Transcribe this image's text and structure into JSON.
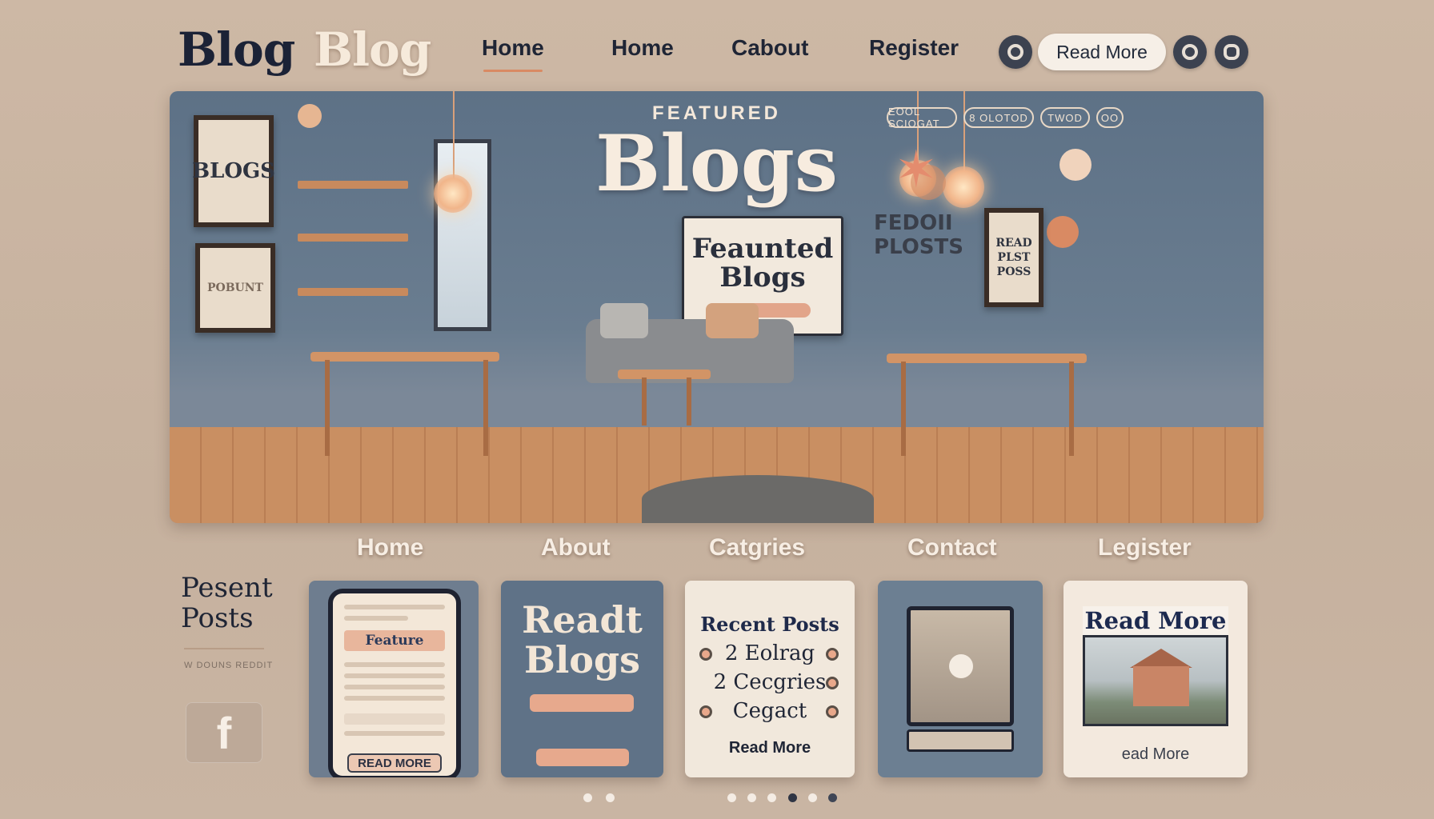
{
  "header": {
    "logo_primary": "Blog",
    "logo_secondary": "Blog",
    "nav": [
      "Home",
      "Home",
      "Cabout",
      "Register"
    ],
    "cta_label": "Read More",
    "icons": [
      "search-icon",
      "record-icon",
      "user-icon"
    ]
  },
  "hero": {
    "kicker": "FEATURED",
    "title": "Blogs",
    "board_title": "Feaunted Blogs",
    "left_frame_top": "BLOGS",
    "left_frame_bottom": "POBUNT",
    "right_sign": "FEDOII PLOSTS",
    "right_frame": "READ PLST POSS",
    "chips": [
      "EOOL SCIOGAT",
      "8 OLOTOD",
      "TWOD",
      "OO"
    ]
  },
  "sub_nav": [
    "Home",
    "About",
    "Catgries",
    "Contact",
    "Legister"
  ],
  "sidebar": {
    "title_line1": "Pesent",
    "title_line2": "Posts",
    "caption": "W DOUNS REDDIT",
    "social_glyph": "f"
  },
  "cards": {
    "phone": {
      "feature_label": "Feature",
      "read_label": "READ MORE"
    },
    "read_blogs": {
      "title": "Readt Blogs"
    },
    "recent": {
      "title": "Recent Posts",
      "items": [
        "2 Eolrag",
        "2 Cecgries",
        "Cegact"
      ],
      "more": "Read More"
    },
    "photo": {
      "title": "Read More",
      "link": "ead More"
    }
  },
  "pager": {
    "count": 8,
    "active_index": 5
  },
  "colors": {
    "background": "#cdb8a5",
    "hero_wall": "#5d7186",
    "accent": "#d98a63",
    "dark_text": "#1f2535"
  }
}
